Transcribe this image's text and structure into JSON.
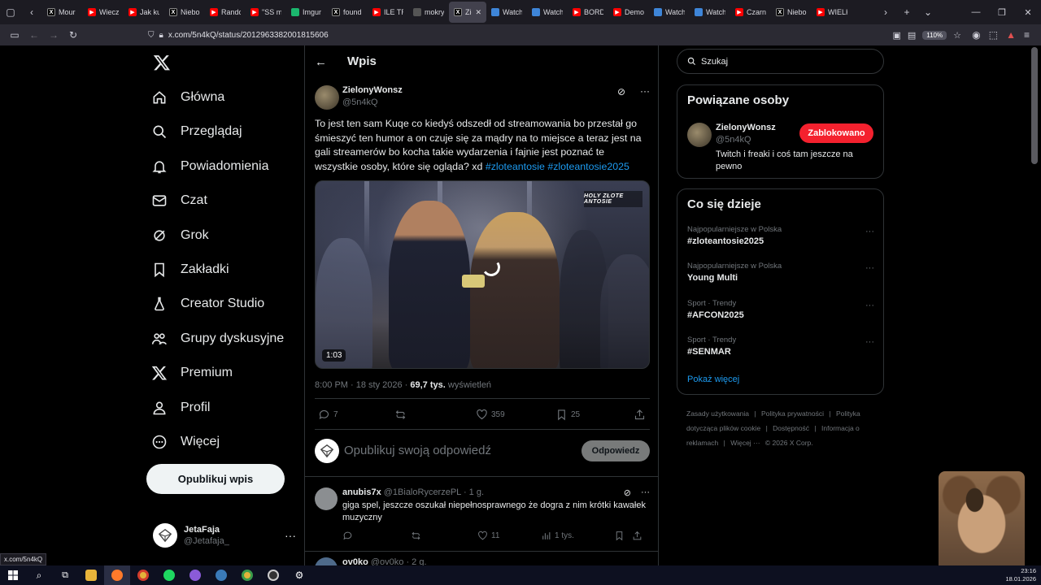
{
  "browser": {
    "tabs": [
      {
        "label": "Mour",
        "icon": "x-icon",
        "color": "#000000"
      },
      {
        "label": "Wiecz",
        "icon": "youtube-icon",
        "color": "#ff0000"
      },
      {
        "label": "Jak ku",
        "icon": "youtube-icon",
        "color": "#ff0000"
      },
      {
        "label": "Niebo",
        "icon": "x-icon",
        "color": "#000000"
      },
      {
        "label": "Rando",
        "icon": "youtube-icon",
        "color": "#ff0000"
      },
      {
        "label": "\"SS m",
        "icon": "youtube-icon",
        "color": "#ff0000"
      },
      {
        "label": "Imgur",
        "icon": "imgur-icon",
        "color": "#1bb76e"
      },
      {
        "label": "found",
        "icon": "x-icon",
        "color": "#000000"
      },
      {
        "label": "ILE TR",
        "icon": "youtube-icon",
        "color": "#ff0000"
      },
      {
        "label": "mokry",
        "icon": "dot-icon",
        "color": "#555555"
      },
      {
        "label": "Zie",
        "icon": "x-icon",
        "color": "#000000",
        "active": true
      },
      {
        "label": "Watch",
        "icon": "watch-icon",
        "color": "#3e85d8"
      },
      {
        "label": "Watch",
        "icon": "watch-icon",
        "color": "#3e85d8"
      },
      {
        "label": "BORD",
        "icon": "youtube-icon",
        "color": "#ff0000"
      },
      {
        "label": "Demo",
        "icon": "youtube-icon",
        "color": "#ff0000"
      },
      {
        "label": "Watch",
        "icon": "watch-icon",
        "color": "#3e85d8"
      },
      {
        "label": "Watch",
        "icon": "watch-icon",
        "color": "#3e85d8"
      },
      {
        "label": "Czarn",
        "icon": "youtube-icon",
        "color": "#ff0000"
      },
      {
        "label": "Niebo",
        "icon": "x-icon",
        "color": "#000000"
      },
      {
        "label": "WIELK",
        "icon": "youtube-icon",
        "color": "#ff0000"
      }
    ],
    "url": "x.com/5n4kQ/status/2012963382001815606",
    "zoom": "110%",
    "status_url": "x.com/5n4kQ"
  },
  "nav": {
    "items": [
      {
        "label": "Główna",
        "icon": "home-icon"
      },
      {
        "label": "Przeglądaj",
        "icon": "search-icon"
      },
      {
        "label": "Powiadomienia",
        "icon": "bell-icon"
      },
      {
        "label": "Czat",
        "icon": "mail-icon"
      },
      {
        "label": "Grok",
        "icon": "grok-icon"
      },
      {
        "label": "Zakładki",
        "icon": "bookmark-icon"
      },
      {
        "label": "Creator Studio",
        "icon": "flask-icon"
      },
      {
        "label": "Grupy dyskusyjne",
        "icon": "people-icon"
      },
      {
        "label": "Premium",
        "icon": "x-icon"
      },
      {
        "label": "Profil",
        "icon": "person-icon"
      },
      {
        "label": "Więcej",
        "icon": "more-circle-icon"
      }
    ],
    "post_button": "Opublikuj wpis",
    "user": {
      "name": "JetaFaja",
      "handle": "@Jetafaja_"
    }
  },
  "post": {
    "header_title": "Wpis",
    "author": "ZielonyWonsz",
    "handle": "@5n4kQ",
    "text": "To jest ten sam Kuqe co kiedyś odszedł od streamowania bo przestał go śmieszyć ten humor a on czuje się za mądry na to miejsce a teraz jest na gali streamerów bo kocha takie wydarzenia i fajnie jest poznać te wszystkie osoby, które się ogląda? xd ",
    "hashtags": [
      "#zloteantosie",
      "#zloteantosie2025"
    ],
    "video_duration": "1:03",
    "video_logo": "HOLY  ZŁOTE ANTOSIE",
    "time": "8:00 PM · 18 sty 2026 · ",
    "views": "69,7 tys.",
    "views_label": " wyświetleń",
    "replies": "7",
    "reposts": "",
    "likes": "359",
    "bookmarks": "25"
  },
  "compose": {
    "placeholder": "Opublikuj swoją odpowiedź",
    "button": "Odpowiedz"
  },
  "replies": [
    {
      "name": "anubis7x",
      "handle": "@1BialoRycerzePL",
      "time": "· 1 g.",
      "text": "giga spel, jeszcze oszukał niepełnosprawnego że dogra z nim krótki kawałek muzyczny",
      "replies": "",
      "reposts": "",
      "likes": "11",
      "views": "1 tys."
    },
    {
      "name": "ov0ko",
      "handle": "@ov0ko",
      "time": "· 2 g."
    }
  ],
  "sidebar": {
    "search_placeholder": "Szukaj",
    "related_title": "Powiązane osoby",
    "related": {
      "name": "ZielonyWonsz",
      "handle": "@5n4kQ",
      "bio": "Twitch i freaki i coś tam jeszcze na pewno",
      "button": "Zablokowano"
    },
    "trends_title": "Co się dzieje",
    "trends": [
      {
        "category": "Najpopularniejsze w Polska",
        "name": "#zloteantosie2025"
      },
      {
        "category": "Najpopularniejsze w Polska",
        "name": "Young Multi"
      },
      {
        "category": "Sport · Trendy",
        "name": "#AFCON2025"
      },
      {
        "category": "Sport · Trendy",
        "name": "#SENMAR"
      }
    ],
    "show_more": "Pokaż więcej",
    "footer": [
      "Zasady użytkowania",
      "|",
      "Polityka prywatności",
      "|",
      "Polityka dotycząca plików cookie",
      "|",
      "Dostępność",
      "|",
      "Informacja o reklamach",
      "|",
      "Więcej ···",
      "© 2026 X Corp."
    ]
  },
  "taskbar": {
    "time": "23:16",
    "date": "18.01.2026"
  },
  "colors": {
    "accent": "#1d9bf0",
    "block": "#f4212e",
    "text_secondary": "#71767b"
  }
}
